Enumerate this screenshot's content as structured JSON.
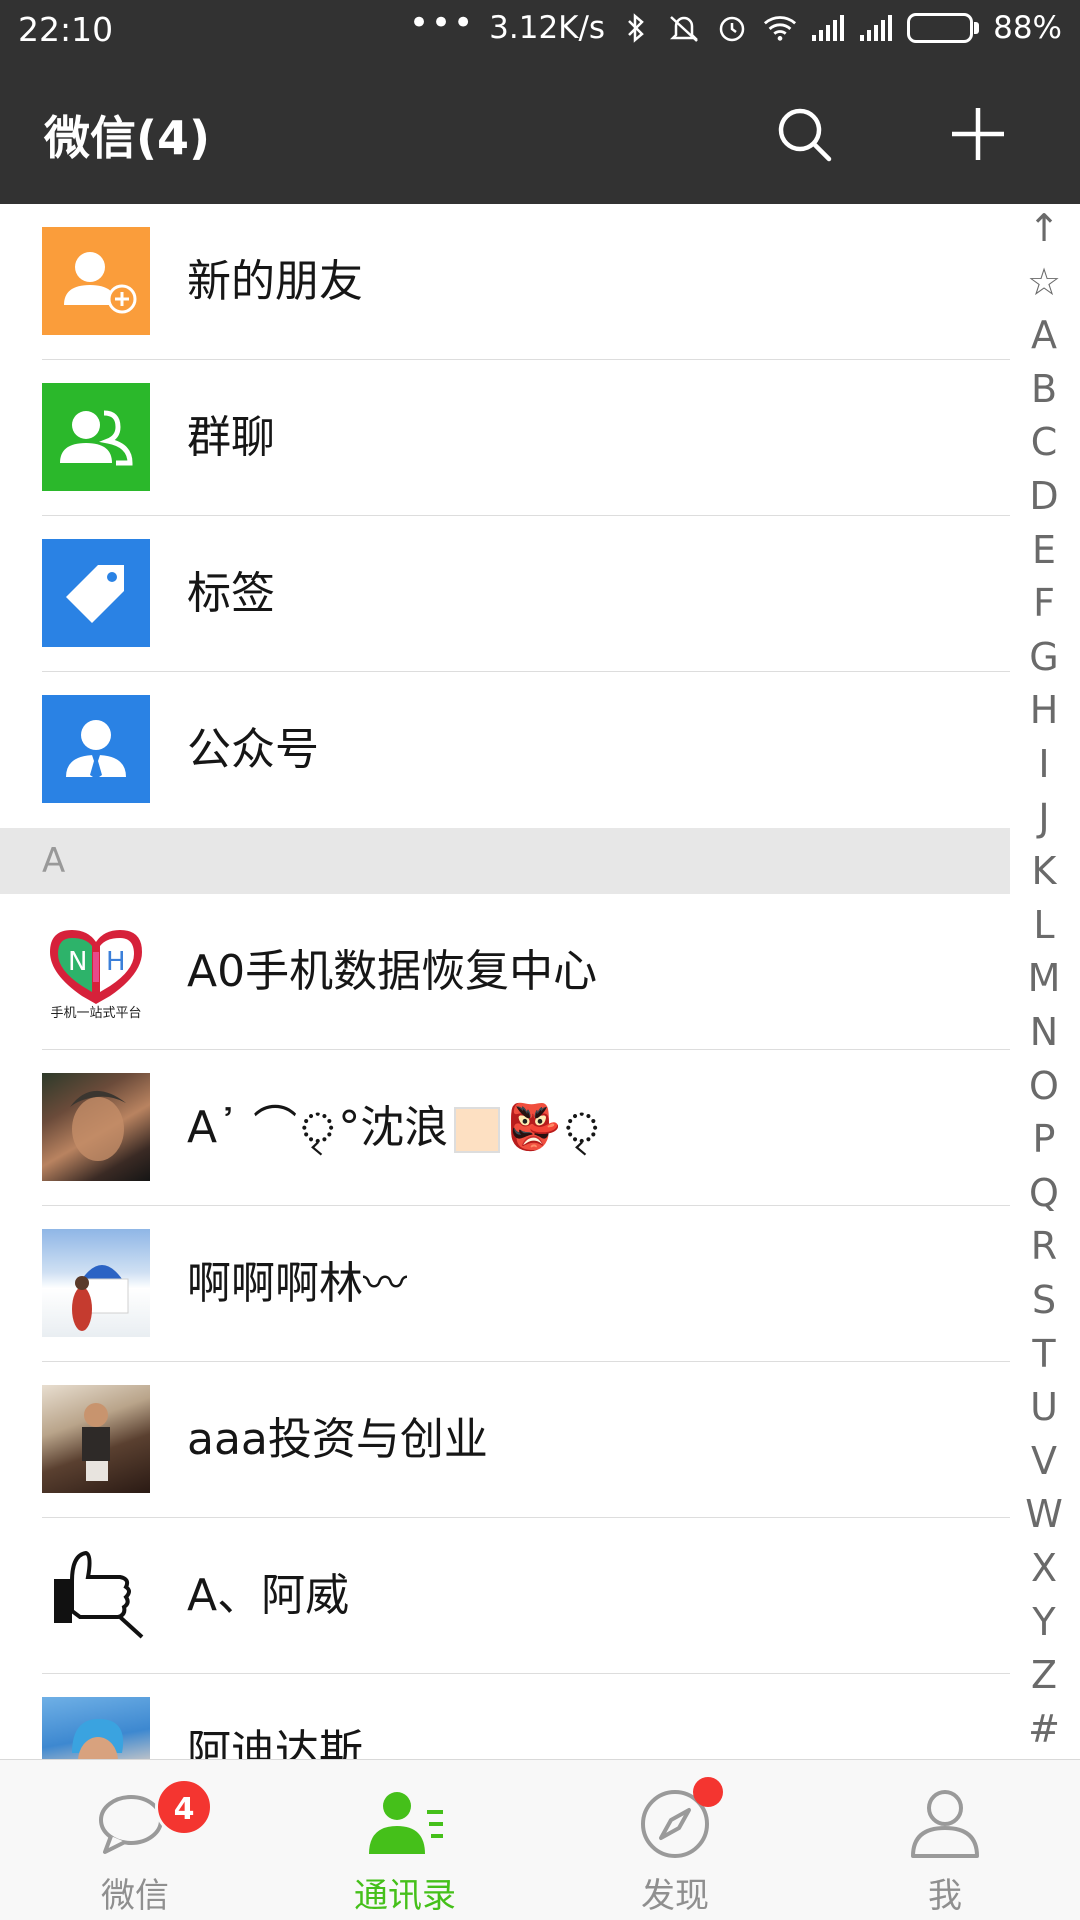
{
  "status_bar": {
    "time": "22:10",
    "network_speed": "3.12K/s",
    "battery_percent": "88%",
    "battery_level": 0.88,
    "icons": [
      "more-dots-icon",
      "bluetooth-icon",
      "mute-icon",
      "alarm-icon",
      "wifi-icon",
      "signal-icon",
      "signal-icon",
      "battery-icon"
    ]
  },
  "header": {
    "title": "微信(4)",
    "actions": [
      "search-icon",
      "plus-icon"
    ]
  },
  "fixed_items": [
    {
      "label": "新的朋友",
      "icon": "add-friend-icon",
      "color": "#fa9d3b"
    },
    {
      "label": "群聊",
      "icon": "group-chat-icon",
      "color": "#2bb82b"
    },
    {
      "label": "标签",
      "icon": "tag-icon",
      "color": "#2a82e4"
    },
    {
      "label": "公众号",
      "icon": "official-account-icon",
      "color": "#2a82e4"
    }
  ],
  "section": {
    "letter": "A"
  },
  "contacts": [
    {
      "name": "A0手机数据恢复中心",
      "logo_text": "手机一站式平台"
    },
    {
      "name": "A᾿ ⌒ৃ°沈浪",
      "emoji": "👺"
    },
    {
      "name": "啊啊啊林〰"
    },
    {
      "name": "aaa投资与创业"
    },
    {
      "name": "A、阿威"
    },
    {
      "name": "阿迪达斯"
    }
  ],
  "index_letters": [
    "↑",
    "☆",
    "A",
    "B",
    "C",
    "D",
    "E",
    "F",
    "G",
    "H",
    "I",
    "J",
    "K",
    "L",
    "M",
    "N",
    "O",
    "P",
    "Q",
    "R",
    "S",
    "T",
    "U",
    "V",
    "W",
    "X",
    "Y",
    "Z",
    "#"
  ],
  "bottom_nav": {
    "tabs": [
      {
        "label": "微信",
        "icon": "chat-bubble-icon",
        "badge": "4"
      },
      {
        "label": "通讯录",
        "icon": "contacts-icon",
        "active": true
      },
      {
        "label": "发现",
        "icon": "compass-icon",
        "red_dot": true
      },
      {
        "label": "我",
        "icon": "person-icon"
      }
    ],
    "active_color": "#45c01a"
  }
}
